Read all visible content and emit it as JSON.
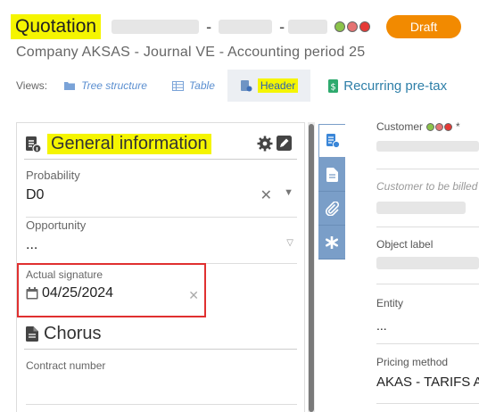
{
  "header": {
    "title": "Quotation",
    "separator": "-",
    "status_badge": "Draft",
    "status_dots": [
      "#8bc34a",
      "#e57373",
      "#e53935"
    ]
  },
  "subtitle": "Company AKSAS  -  Journal VE  -  Accounting period 25",
  "views": {
    "label": "Views:",
    "items": [
      {
        "label": "Tree structure",
        "icon": "folder-icon"
      },
      {
        "label": "Table",
        "icon": "table-icon"
      },
      {
        "label": "Header",
        "icon": "header-icon",
        "active": true
      }
    ],
    "recurring_label": "Recurring pre-tax"
  },
  "general_section": {
    "title": "General information",
    "fields": {
      "probability": {
        "label": "Probability",
        "value": "D0"
      },
      "opportunity": {
        "label": "Opportunity",
        "value": "..."
      },
      "signature": {
        "label": "Actual signature",
        "value": "04/25/2024"
      }
    }
  },
  "chorus_section": {
    "title": "Chorus",
    "contract_label": "Contract number",
    "contract_value": ""
  },
  "right_column": {
    "customer_label": "Customer",
    "customer_required": "*",
    "billed_label": "Customer to be billed",
    "object_label": "Object label",
    "entity_label": "Entity",
    "entity_value": "...",
    "pricing_label": "Pricing method",
    "pricing_value": "AKAS - TARIFS A"
  },
  "colors": {
    "accent": "#f28a00",
    "highlight": "#f5f500",
    "link": "#5b8fd0",
    "side_tab": "#7a9ec8",
    "error_box": "#e03030"
  }
}
